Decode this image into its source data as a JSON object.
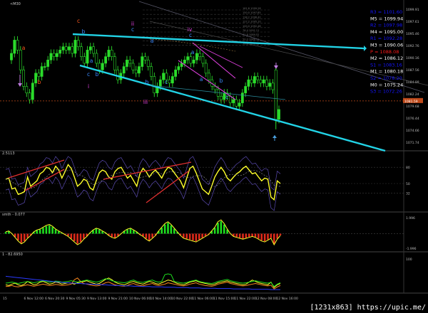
{
  "chart_data": [
    {
      "type": "candlestick",
      "title": "<M30",
      "ylim": [
        1068,
        1110
      ],
      "y_ticks": [
        "1099.91",
        "1097.61",
        "1095.46",
        "1092.76",
        "1090.16",
        "1087.56",
        "1084.88",
        "1082.24",
        "1079.68",
        "1076.44",
        "1074.66",
        "1071.74"
      ],
      "close": [
        1096,
        1100,
        1097,
        1091,
        1086,
        1084,
        1082,
        1087,
        1090,
        1089,
        1092,
        1092,
        1094,
        1096,
        1095,
        1096,
        1097,
        1098,
        1097,
        1098,
        1096,
        1100,
        1098,
        1095,
        1093,
        1097,
        1098,
        1096,
        1093,
        1091,
        1093,
        1095,
        1097,
        1095,
        1091,
        1088,
        1090,
        1092,
        1094,
        1093,
        1091,
        1090,
        1092,
        1095,
        1094,
        1092,
        1089,
        1084,
        1086,
        1088,
        1090,
        1088,
        1087,
        1089,
        1091,
        1092,
        1093,
        1094,
        1095,
        1093,
        1094,
        1096,
        1095,
        1093,
        1090,
        1088,
        1086,
        1085,
        1083,
        1082,
        1084,
        1083,
        1081,
        1082,
        1080,
        1081,
        1084,
        1086,
        1088,
        1087,
        1089,
        1088,
        1087,
        1088,
        1086,
        1087,
        1085,
        1076,
        1079
      ],
      "current_price": "1081.59",
      "wave_labels": [
        {
          "t": "c",
          "color": "#ff5a1e"
        },
        {
          "t": "b",
          "color": "#3b8bff"
        },
        {
          "t": "a",
          "color": "#ff5a1e"
        },
        {
          "t": "b",
          "color": "#ff5a1e"
        },
        {
          "t": "a",
          "color": "#3b8bff"
        },
        {
          "t": "c",
          "color": "#3b8bff"
        },
        {
          "t": "b",
          "color": "#3b8bff"
        },
        {
          "t": "i",
          "color": "#e040e0"
        },
        {
          "t": "ii",
          "color": "#e040e0"
        },
        {
          "t": "c",
          "color": "#3b8bff"
        },
        {
          "t": "a",
          "color": "#3b8bff"
        },
        {
          "t": "b",
          "color": "#3b8bff"
        },
        {
          "t": "c",
          "color": "#3b8bff"
        },
        {
          "t": "iii",
          "color": "#e040e0"
        },
        {
          "t": "iv",
          "color": "#e040e0"
        },
        {
          "t": "c",
          "color": "#3b8bff"
        },
        {
          "t": "a",
          "color": "#3b8bff"
        },
        {
          "t": "a",
          "color": "#3b8bff"
        },
        {
          "t": "b",
          "color": "#3b8bff"
        },
        {
          "t": "c",
          "color": "#3b8bff"
        }
      ],
      "fib_levels": [
        "161.8  1099.28",
        "150.0  1097.85",
        "138.2  1096.42",
        "127.2  1095.10",
        "100.0  1092.48",
        "76.4  1091.11",
        "61.8  1089.52",
        "50.0  1088.11",
        "38.2  1086.62"
      ],
      "levels": [
        {
          "label": "R3 = 1101.60",
          "color": "#1515ff"
        },
        {
          "label": "M5 = 1099.94",
          "color": "#ffffff"
        },
        {
          "label": "R2 = 1097.98",
          "color": "#1515ff"
        },
        {
          "label": "M4 = 1095.00",
          "color": "#ffffff"
        },
        {
          "label": "R1 = 1092.28",
          "color": "#1515ff"
        },
        {
          "label": "M3 = 1090.06",
          "color": "#ffffff"
        },
        {
          "label": "P = 1088.08",
          "color": "#ff1a1a"
        },
        {
          "label": "M2 = 1086.12",
          "color": "#ffffff"
        },
        {
          "label": "S1 = 1083.16",
          "color": "#1515ff"
        },
        {
          "label": "M1 = 1080.18",
          "color": "#ffffff"
        },
        {
          "label": "S2 = 1078.20",
          "color": "#1515ff"
        },
        {
          "label": "M0 = 1075.24",
          "color": "#ffffff"
        },
        {
          "label": "S3 = 1072.26",
          "color": "#1515ff"
        }
      ]
    },
    {
      "type": "line",
      "title": "2.5113",
      "ylim": [
        0,
        100
      ],
      "y_ticks": [
        "80",
        "50",
        "32"
      ],
      "values": [
        58,
        60,
        40,
        42,
        30,
        32,
        35,
        62,
        45,
        50,
        55,
        68,
        72,
        80,
        78,
        70,
        82,
        75,
        60,
        72,
        85,
        78,
        62,
        45,
        50,
        58,
        55,
        42,
        38,
        55,
        70,
        75,
        72,
        62,
        58,
        72,
        78,
        80,
        70,
        60,
        65,
        55,
        45,
        68,
        78,
        72,
        62,
        70,
        75,
        68,
        60,
        72,
        80,
        78,
        70,
        62,
        55,
        42,
        60,
        78,
        82,
        70,
        55,
        40,
        35,
        30,
        45,
        62,
        72,
        80,
        72,
        60,
        55,
        62,
        68,
        72,
        78,
        82,
        75,
        68,
        70,
        62,
        55,
        60,
        58,
        25,
        20,
        55,
        50
      ]
    },
    {
      "type": "bar",
      "title": "smth - 0.077",
      "ylim": [
        -2,
        2
      ],
      "y_ticks": [
        "1.996",
        "-1.996"
      ],
      "values": [
        0.2,
        0.3,
        0.0,
        -0.4,
        -0.8,
        -1.1,
        -0.9,
        -0.5,
        -0.2,
        0.2,
        0.4,
        0.5,
        0.7,
        0.9,
        1.0,
        0.8,
        0.5,
        0.3,
        0.1,
        -0.1,
        -0.3,
        -0.6,
        -0.9,
        -1.2,
        -1.0,
        -0.6,
        -0.3,
        0.1,
        0.4,
        0.6,
        0.5,
        0.3,
        0.1,
        -0.2,
        -0.4,
        -0.5,
        -0.3,
        0.0,
        0.3,
        0.5,
        0.6,
        0.4,
        0.2,
        -0.1,
        -0.3,
        -0.6,
        -0.8,
        -0.5,
        -0.2,
        0.3,
        0.7,
        1.1,
        1.3,
        1.0,
        0.6,
        0.2,
        -0.2,
        -0.5,
        -0.6,
        -0.7,
        -0.8,
        -0.9,
        -0.7,
        -0.5,
        -0.3,
        -0.1,
        0.3,
        0.7,
        1.3,
        1.5,
        1.1,
        0.5,
        0.0,
        -0.3,
        -0.4,
        -0.5,
        -0.6,
        -0.5,
        -0.4,
        -0.3,
        -0.4,
        -0.6,
        -0.8,
        -0.9,
        -0.7,
        -0.5,
        -1.2,
        -0.6,
        -0.2
      ]
    },
    {
      "type": "line",
      "title": "1 - 82.6950",
      "ylim": [
        0,
        100
      ],
      "y_ticks": [
        "100"
      ],
      "series": [
        {
          "color": "#ffff2a",
          "values": [
            20,
            18,
            22,
            25,
            20,
            18,
            22,
            30,
            25,
            20,
            22,
            28,
            30,
            26,
            22,
            24,
            28,
            26,
            22,
            24,
            26,
            25,
            22,
            26,
            28,
            30,
            32,
            28,
            25,
            22,
            24,
            30,
            36,
            40,
            35,
            28,
            24,
            22,
            20,
            24,
            28,
            30,
            26,
            24,
            22,
            26,
            30,
            28,
            24,
            22,
            26,
            30,
            34,
            32,
            28,
            24,
            22,
            20,
            24,
            28,
            30,
            32,
            28,
            26,
            24,
            22,
            20,
            22,
            26,
            28,
            30,
            32,
            28,
            26,
            24,
            22,
            20,
            22,
            28,
            34,
            30,
            26,
            24,
            22,
            20,
            28,
            12,
            20,
            24
          ]
        },
        {
          "color": "#ff8a1e",
          "values": [
            15,
            16,
            18,
            15,
            14,
            16,
            18,
            20,
            18,
            16,
            18,
            20,
            22,
            20,
            18,
            19,
            21,
            20,
            18,
            19,
            20,
            22,
            35,
            40,
            30,
            24,
            22,
            20,
            18,
            17,
            18,
            22,
            26,
            28,
            24,
            20,
            18,
            17,
            16,
            18,
            22,
            24,
            20,
            18,
            17,
            20,
            22,
            24,
            20,
            18,
            20,
            22,
            26,
            24,
            22,
            20,
            18,
            17,
            19,
            22,
            24,
            26,
            22,
            20,
            18,
            17,
            16,
            18,
            22,
            24,
            26,
            28,
            24,
            22,
            20,
            18,
            17,
            18,
            20,
            22,
            24,
            22,
            20,
            18,
            17,
            19,
            8,
            14,
            18
          ]
        },
        {
          "color": "#1ee01e",
          "values": [
            25,
            26,
            28,
            26,
            24,
            26,
            28,
            30,
            28,
            26,
            28,
            30,
            32,
            30,
            28,
            29,
            31,
            30,
            28,
            29,
            30,
            32,
            30,
            28,
            30,
            32,
            34,
            32,
            30,
            28,
            30,
            34,
            38,
            36,
            32,
            30,
            28,
            27,
            26,
            28,
            32,
            34,
            30,
            28,
            27,
            30,
            32,
            34,
            30,
            28,
            30,
            50,
            52,
            50,
            30,
            28,
            26,
            25,
            27,
            30,
            32,
            34,
            30,
            28,
            26,
            25,
            24,
            26,
            30,
            32,
            34,
            36,
            32,
            30,
            28,
            26,
            25,
            26,
            28,
            30,
            32,
            30,
            28,
            26,
            25,
            27,
            15,
            22,
            26
          ]
        },
        {
          "color": "#2a3aff",
          "values": [
            45,
            44,
            43,
            42,
            41,
            40,
            39,
            38,
            37,
            36,
            35,
            34,
            33,
            32,
            31,
            30,
            29,
            28,
            27,
            26,
            26,
            25,
            25,
            24,
            24,
            23,
            23,
            22,
            22,
            21,
            21,
            20,
            20,
            19,
            19,
            18,
            18,
            18,
            17,
            17,
            17,
            16,
            16,
            16,
            15,
            15,
            15,
            14,
            14,
            14,
            14,
            13,
            13,
            13,
            13,
            12,
            12,
            12,
            12,
            11,
            11,
            11,
            11,
            10,
            10,
            10,
            10,
            10,
            9,
            9,
            9,
            9,
            9,
            8,
            8,
            8,
            8,
            8,
            8,
            7,
            7,
            7,
            7,
            7,
            7,
            6,
            6,
            6,
            6
          ]
        }
      ]
    }
  ],
  "x_ticks": [
    "15",
    "6 Nov 12:00",
    "6 Nov 20:30",
    "9 Nov 05:30",
    "9 Nov 13:00",
    "9 Nov 21:00",
    "10 Nov 06:00",
    "10 Nov 14:00",
    "10 Nov 22:00",
    "11 Nov 06:00",
    "11 Nov 15:00",
    "11 Nov 22:00",
    "12 Nov 08:00",
    "12 Nov 16:00"
  ],
  "watermark": "[1231x863] https://upic.me/",
  "colors": {
    "up": "#2bdc2b",
    "down": "#2bdc2b",
    "trend": "#22d3e6",
    "pink": "#e040e0",
    "grid": "#1a1a1a"
  }
}
